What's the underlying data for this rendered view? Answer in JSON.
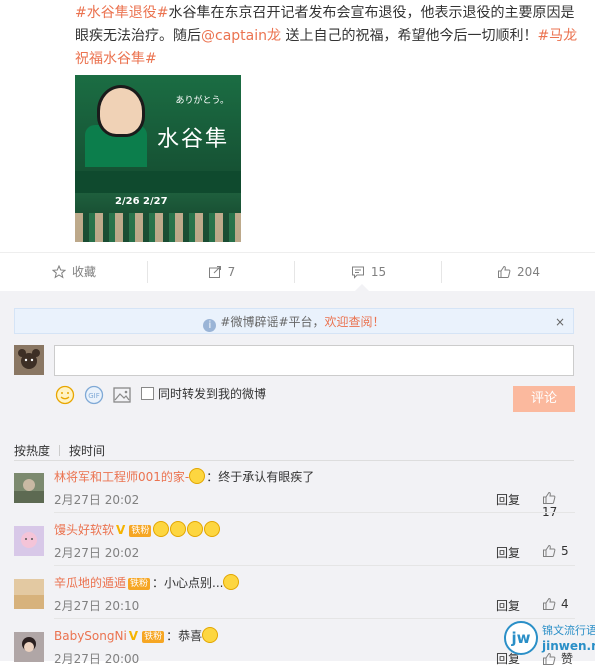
{
  "post": {
    "tag1": "#水谷隼退役#",
    "text1": "水谷隼在东京召开记者发布会宣布退役，他表示退役的主要原因是眼疾无法治疗。随后",
    "mention": "@captain龙",
    "text2": " 送上自己的祝福，希望他今后一切顺利！",
    "tag2": "#马龙祝福水谷隼#",
    "image": {
      "title": "水谷隼",
      "subtitle": "ありがとう。",
      "date": "2/26 2/27"
    }
  },
  "actions": {
    "favorite_label": "收藏",
    "repost_count": "7",
    "comment_count": "15",
    "like_count": "204"
  },
  "notice": {
    "prefix": "#微博辟谣#平台，",
    "link": "欢迎查阅！",
    "close": "×"
  },
  "composer": {
    "repost_label": "同时转发到我的微博",
    "submit_label": "评论"
  },
  "sort": {
    "by_hot": "按热度",
    "by_time": "按时间"
  },
  "comments": [
    {
      "user": "林将军和工程师001的家-",
      "text": "：终于承认有眼疾了",
      "time": "2月27日 20:02",
      "reply": "回复",
      "likes": "17",
      "avatar_color": "#7c8a6f"
    },
    {
      "user": "馒头好软软",
      "badge": "铁粉",
      "text": "",
      "time": "2月27日 20:02",
      "reply": "回复",
      "likes": "5",
      "avatar_color": "#d8c8e8"
    },
    {
      "user": "辛瓜地的遁遁",
      "badge": "铁粉",
      "text": "：小心点别...",
      "time": "2月27日 20:10",
      "reply": "回复",
      "likes": "4",
      "avatar_color": "#e3c9a2"
    },
    {
      "user": "BabySongNi",
      "badge": "铁粉",
      "text": "：恭喜",
      "time": "2月27日 20:00",
      "reply": "回复",
      "likes": "赞",
      "avatar_color": "#b0a6a6"
    }
  ],
  "watermark": {
    "logo": "jw",
    "title": "锦文流行语",
    "url": "jinwen.net"
  }
}
